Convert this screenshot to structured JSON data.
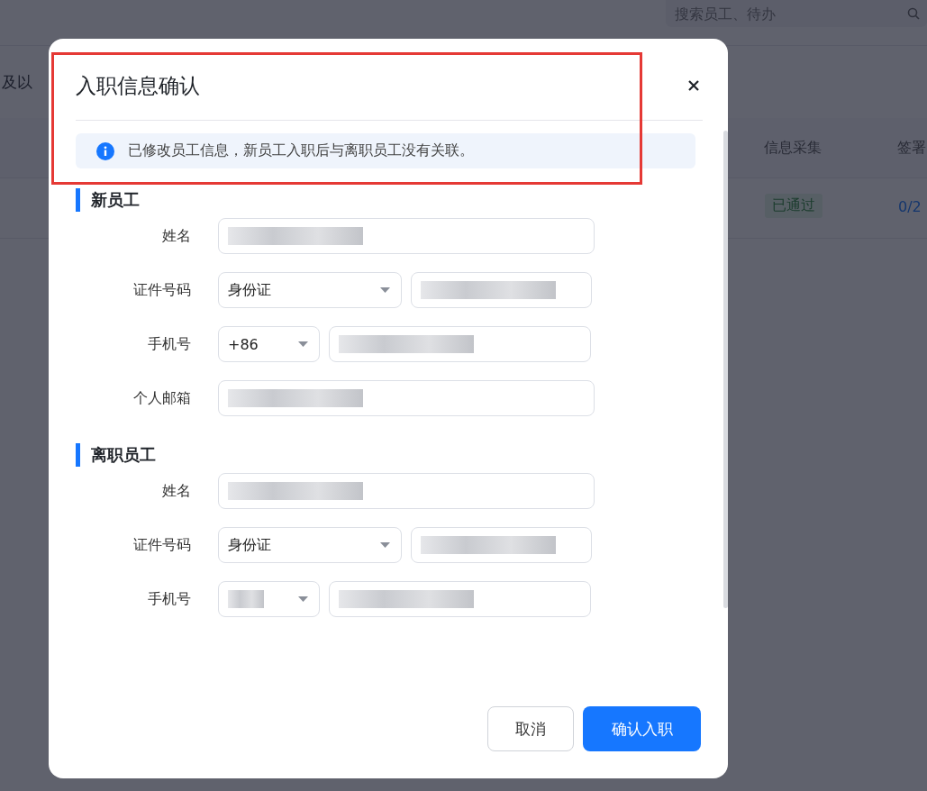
{
  "background_page": {
    "search": {
      "placeholder": "搜索员工、待办"
    },
    "filter_text": "及以",
    "columns": [
      "信息采集",
      "签署"
    ],
    "row": {
      "status_tag": "已通过",
      "count": "0/2"
    }
  },
  "dialog": {
    "title": "入职信息确认",
    "notice": "已修改员工信息，新员工入职后与离职员工没有关联。",
    "sections": [
      {
        "title": "新员工",
        "fields": [
          {
            "label": "姓名",
            "kind": "text",
            "controls": [
              {
                "kind": "input"
              }
            ]
          },
          {
            "label": "证件号码",
            "kind": "document",
            "controls": [
              {
                "kind": "select",
                "value": "身份证"
              },
              {
                "kind": "input"
              }
            ]
          },
          {
            "label": "手机号",
            "kind": "phone",
            "controls": [
              {
                "kind": "select",
                "value": "+86"
              },
              {
                "kind": "input"
              }
            ]
          },
          {
            "label": "个人邮箱",
            "kind": "text",
            "controls": [
              {
                "kind": "input"
              }
            ]
          }
        ]
      },
      {
        "title": "离职员工",
        "fields": [
          {
            "label": "姓名",
            "kind": "text",
            "controls": [
              {
                "kind": "input"
              }
            ]
          },
          {
            "label": "证件号码",
            "kind": "document",
            "controls": [
              {
                "kind": "select",
                "value": "身份证"
              },
              {
                "kind": "input"
              }
            ]
          },
          {
            "label": "手机号",
            "kind": "phone",
            "controls": [
              {
                "kind": "select"
              },
              {
                "kind": "input"
              }
            ]
          }
        ]
      }
    ],
    "buttons": [
      {
        "label": "取消",
        "kind": "secondary"
      },
      {
        "label": "确认入职",
        "kind": "primary"
      }
    ]
  }
}
